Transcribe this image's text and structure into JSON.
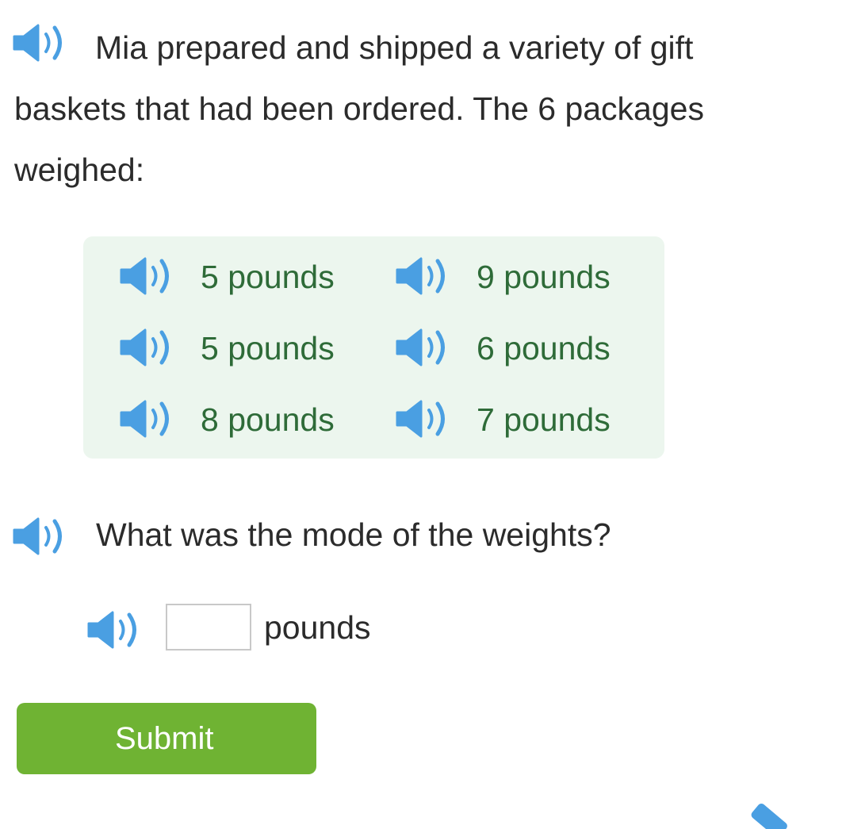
{
  "colors": {
    "speaker_blue": "#4a9fe2",
    "weights_text_green": "#2e6b38",
    "weights_box_bg": "#ecf6ee",
    "submit_green": "#6fb333"
  },
  "question": {
    "text": "Mia prepared and shipped a variety of gift baskets that had been ordered. The 6 packages weighed:",
    "speaker_icon": "speaker-icon"
  },
  "weights": [
    {
      "label": "5 pounds"
    },
    {
      "label": "9 pounds"
    },
    {
      "label": "5 pounds"
    },
    {
      "label": "6 pounds"
    },
    {
      "label": "8 pounds"
    },
    {
      "label": "7 pounds"
    }
  ],
  "prompt": {
    "text": "What was the mode of the weights?"
  },
  "answer": {
    "value": "",
    "placeholder": "",
    "unit_label": "pounds"
  },
  "submit": {
    "label": "Submit"
  },
  "toolbar": {
    "icon": "pencil-icon"
  }
}
